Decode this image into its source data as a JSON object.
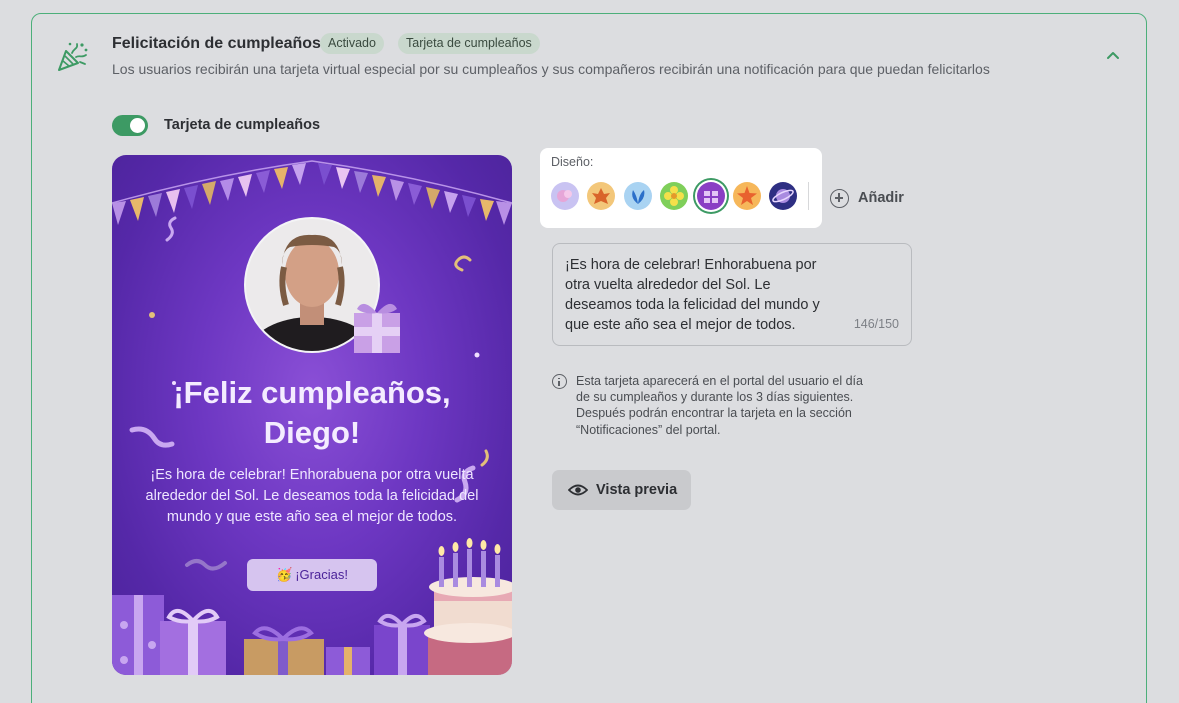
{
  "section": {
    "title": "Felicitación de cumpleaños",
    "badges": [
      "Activado",
      "Tarjeta de cumpleaños"
    ],
    "subtitle": "Los usuarios recibirán una tarjeta virtual especial por su cumpleaños y sus compañeros recibirán una notificación para que puedan felicitarlos",
    "icon": "party-popper-icon",
    "collapse_icon": "chevron-up-icon"
  },
  "toggle": {
    "label": "Tarjeta de cumpleaños",
    "on": true
  },
  "card": {
    "title_line1": "¡Feliz cumpleaños,",
    "title_line2": "Diego!",
    "message": "¡Es hora de celebrar! Enhorabuena por otra vuelta alrededor del Sol. Le deseamos toda la felicidad del mundo y que este año sea el mejor de todos.",
    "button_label": "¡Gracias!",
    "button_emoji": "🥳"
  },
  "design": {
    "label": "Diseño:",
    "selected_index": 4,
    "add_label": "Añadir",
    "swatches": [
      {
        "name": "pink-swatch",
        "color": "#c9c3f2"
      },
      {
        "name": "autumn-leaf-swatch",
        "color": "#f3c77a"
      },
      {
        "name": "blue-leaf-swatch",
        "color": "#a9d3f2"
      },
      {
        "name": "flower-swatch",
        "color": "#7fcf5a"
      },
      {
        "name": "gift-swatch",
        "color": "#8a3fc4"
      },
      {
        "name": "starfish-swatch",
        "color": "#f6b75a"
      },
      {
        "name": "planet-swatch",
        "color": "#2e2f83"
      }
    ]
  },
  "message_field": {
    "value": "¡Es hora de celebrar! Enhorabuena por otra vuelta alrededor del Sol. Le deseamos toda la felicidad del mundo y que este año sea el mejor de todos.",
    "counter": "146/150"
  },
  "info": {
    "text": "Esta tarjeta aparecerá en el portal del usuario el día de su cumpleaños y durante los 3 días siguientes. Después podrán encontrar la tarjeta en la sección “Notificaciones” del portal."
  },
  "preview": {
    "label": "Vista previa",
    "icon": "eye-icon"
  },
  "colors": {
    "accent": "#3d9a64",
    "card_purple": "#6d37c2"
  }
}
